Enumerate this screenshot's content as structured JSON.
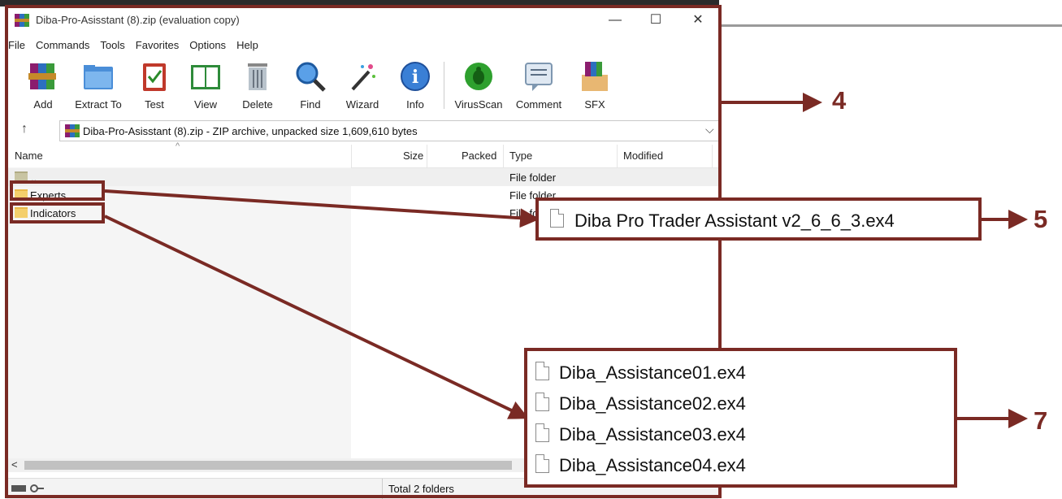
{
  "window": {
    "title": "Diba-Pro-Asisstant (8).zip (evaluation copy)",
    "minimize_glyph": "—",
    "maximize_glyph": "☐",
    "close_glyph": "✕"
  },
  "menu": [
    "File",
    "Commands",
    "Tools",
    "Favorites",
    "Options",
    "Help"
  ],
  "toolbar": [
    {
      "label": "Add",
      "icon": "add-archive-icon"
    },
    {
      "label": "Extract To",
      "icon": "extract-folder-icon"
    },
    {
      "label": "Test",
      "icon": "test-clipboard-icon"
    },
    {
      "label": "View",
      "icon": "view-book-icon"
    },
    {
      "label": "Delete",
      "icon": "trash-icon"
    },
    {
      "label": "Find",
      "icon": "magnifier-icon"
    },
    {
      "label": "Wizard",
      "icon": "wand-icon"
    },
    {
      "label": "Info",
      "icon": "info-icon"
    },
    {
      "label": "VirusScan",
      "icon": "bug-scan-icon"
    },
    {
      "label": "Comment",
      "icon": "comment-icon"
    },
    {
      "label": "SFX",
      "icon": "sfx-box-icon"
    }
  ],
  "address": {
    "up_glyph": "↑",
    "text": "Diba-Pro-Asisstant (8).zip - ZIP archive, unpacked size 1,609,610 bytes",
    "dropdown_glyph": "⌵"
  },
  "columns": {
    "name": "Name",
    "size": "Size",
    "packed": "Packed",
    "type": "Type",
    "modified": "Modified",
    "sort_glyph": "^"
  },
  "rows": [
    {
      "name": "..",
      "type": "File folder"
    },
    {
      "name": "Experts",
      "type": "File folder"
    },
    {
      "name": "Indicators",
      "type": "File folder"
    }
  ],
  "scroll_left_glyph": "<",
  "status": {
    "text": "Total 2 folders"
  },
  "callouts": {
    "toolbar_number": "4",
    "experts_number": "5",
    "indicators_number": "7",
    "experts_file": "Diba Pro Trader Assistant v2_6_6_3.ex4",
    "indicator_files": [
      "Diba_Assistance01.ex4",
      "Diba_Assistance02.ex4",
      "Diba_Assistance03.ex4",
      "Diba_Assistance04.ex4"
    ]
  },
  "colors": {
    "annotation": "#7a2a24",
    "folder": "#f4cf6c"
  }
}
